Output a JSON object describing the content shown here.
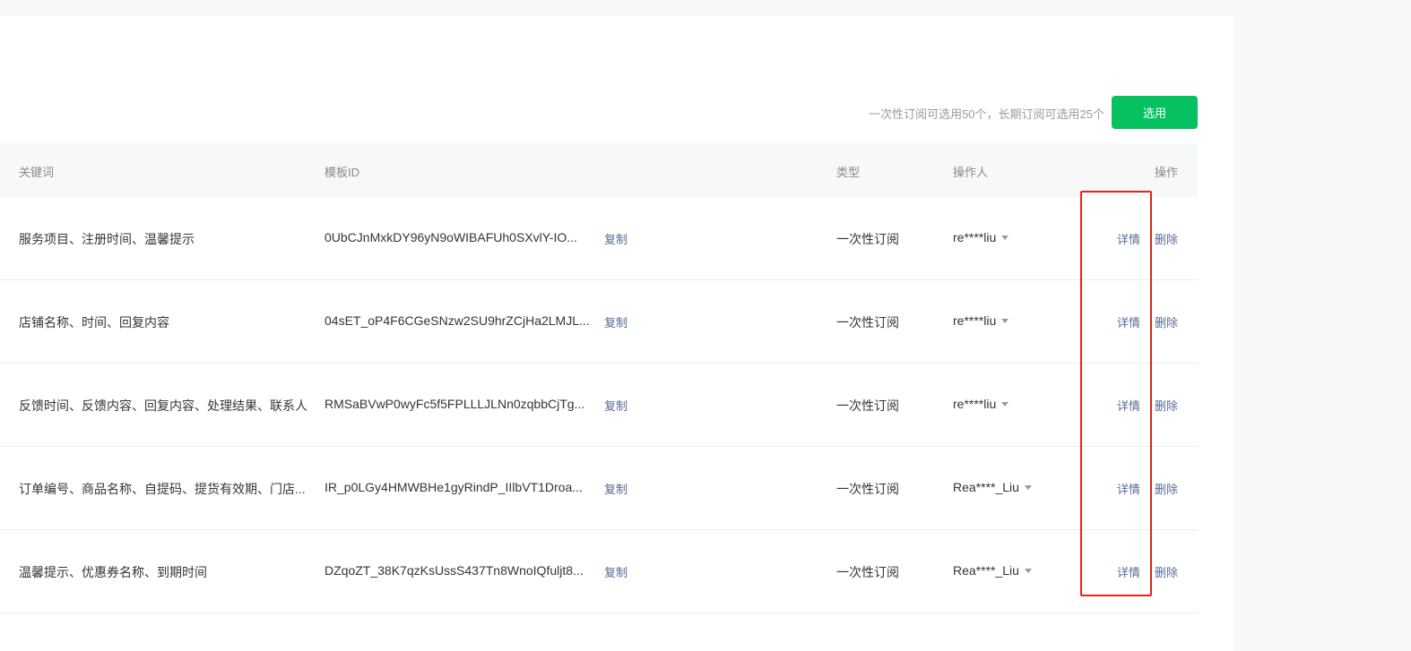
{
  "toolbar": {
    "hint": "一次性订阅可选用50个，长期订阅可选用25个",
    "select_label": "选用",
    "accent_color": "#07c160"
  },
  "table": {
    "headers": {
      "keywords": "关键词",
      "template_id": "模板ID",
      "type": "类型",
      "operator": "操作人",
      "actions": "操作"
    },
    "rows": [
      {
        "keywords": "服务项目、注册时间、温馨提示",
        "template_id": "0UbCJnMxkDY96yN9oWIBAFUh0SXvlY-IO...",
        "copy": "复制",
        "type": "一次性订阅",
        "operator": "re****liu",
        "detail": "详情",
        "delete": "删除"
      },
      {
        "keywords": "店铺名称、时间、回复内容",
        "template_id": "04sET_oP4F6CGeSNzw2SU9hrZCjHa2LMJL...",
        "copy": "复制",
        "type": "一次性订阅",
        "operator": "re****liu",
        "detail": "详情",
        "delete": "删除"
      },
      {
        "keywords": "反馈时间、反馈内容、回复内容、处理结果、联系人",
        "template_id": "RMSaBVwP0wyFc5f5FPLLLJLNn0zqbbCjTg...",
        "copy": "复制",
        "type": "一次性订阅",
        "operator": "re****liu",
        "detail": "详情",
        "delete": "删除"
      },
      {
        "keywords": "订单编号、商品名称、自提码、提货有效期、门店...",
        "template_id": "IR_p0LGy4HMWBHe1gyRindP_IIlbVT1Droa...",
        "copy": "复制",
        "type": "一次性订阅",
        "operator": "Rea****_Liu",
        "detail": "详情",
        "delete": "删除"
      },
      {
        "keywords": "温馨提示、优惠券名称、到期时间",
        "template_id": "DZqoZT_38K7qzKsUssS437Tn8WnoIQfuljt8...",
        "copy": "复制",
        "type": "一次性订阅",
        "operator": "Rea****_Liu",
        "detail": "详情",
        "delete": "删除"
      }
    ]
  },
  "annotation_color": "#e0261e"
}
